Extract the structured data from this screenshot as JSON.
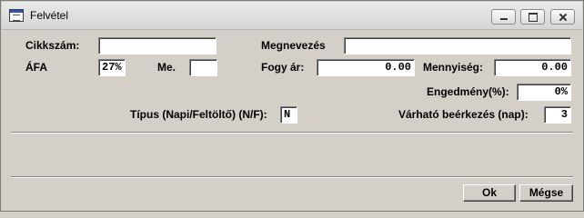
{
  "window": {
    "title": "Felvétel",
    "icon": "form-window-icon"
  },
  "form": {
    "cikkszam": {
      "label": "Cikkszám:",
      "value": ""
    },
    "megnevezes": {
      "label": "Megnevezés",
      "value": ""
    },
    "afa": {
      "label": "ÁFA",
      "value": "27%"
    },
    "me": {
      "label": "Me.",
      "value": ""
    },
    "fogy_ar": {
      "label": "Fogy ár:",
      "value": "0.00"
    },
    "mennyiseg": {
      "label": "Mennyiség:",
      "value": "0.00"
    },
    "engedmeny": {
      "label": "Engedmény(%):",
      "value": "0%"
    },
    "tipus": {
      "label": "Típus (Napi/Feltöltő) (N/F):",
      "value": "N"
    },
    "varhato": {
      "label": "Várható beérkezés (nap):",
      "value": "3"
    }
  },
  "buttons": {
    "ok": "Ok",
    "cancel": "Mégse"
  }
}
